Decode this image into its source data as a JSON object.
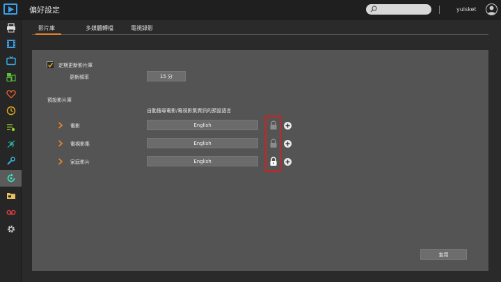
{
  "header": {
    "title": "偏好設定",
    "search_placeholder": "",
    "username": "yuisket"
  },
  "sidebar": {
    "items": [
      {
        "icon": "printer-icon"
      },
      {
        "icon": "film-icon"
      },
      {
        "icon": "tv-icon"
      },
      {
        "icon": "media-library-icon"
      },
      {
        "icon": "heart-icon"
      },
      {
        "icon": "clock-icon"
      },
      {
        "icon": "playlist-icon"
      },
      {
        "icon": "satellite-icon"
      },
      {
        "icon": "wrench-icon"
      },
      {
        "icon": "refresh-icon",
        "active": true
      },
      {
        "icon": "folder-icon"
      },
      {
        "icon": "recorder-icon"
      },
      {
        "icon": "gear-icon"
      }
    ]
  },
  "tabs": [
    {
      "label": "影片庫",
      "active": true
    },
    {
      "label": "多媒體轉檔"
    },
    {
      "label": "電視錄影"
    }
  ],
  "settings": {
    "auto_update_label": "定期更新影片庫",
    "auto_update_checked": true,
    "frequency_label": "更新頻率",
    "frequency_value": "15 分",
    "preset_library_label": "預設影片庫",
    "language_header": "自動搜尋電影/電視影集資訊的預設語言",
    "libraries": [
      {
        "name": "電影",
        "language": "English",
        "locked": false
      },
      {
        "name": "電視影集",
        "language": "English",
        "locked": false
      },
      {
        "name": "家庭影片",
        "language": "English",
        "locked": true
      }
    ],
    "apply_label": "套用"
  },
  "colors": {
    "accent": "#e8832a",
    "highlight": "#d42020",
    "checkbox": "#e8a020"
  }
}
